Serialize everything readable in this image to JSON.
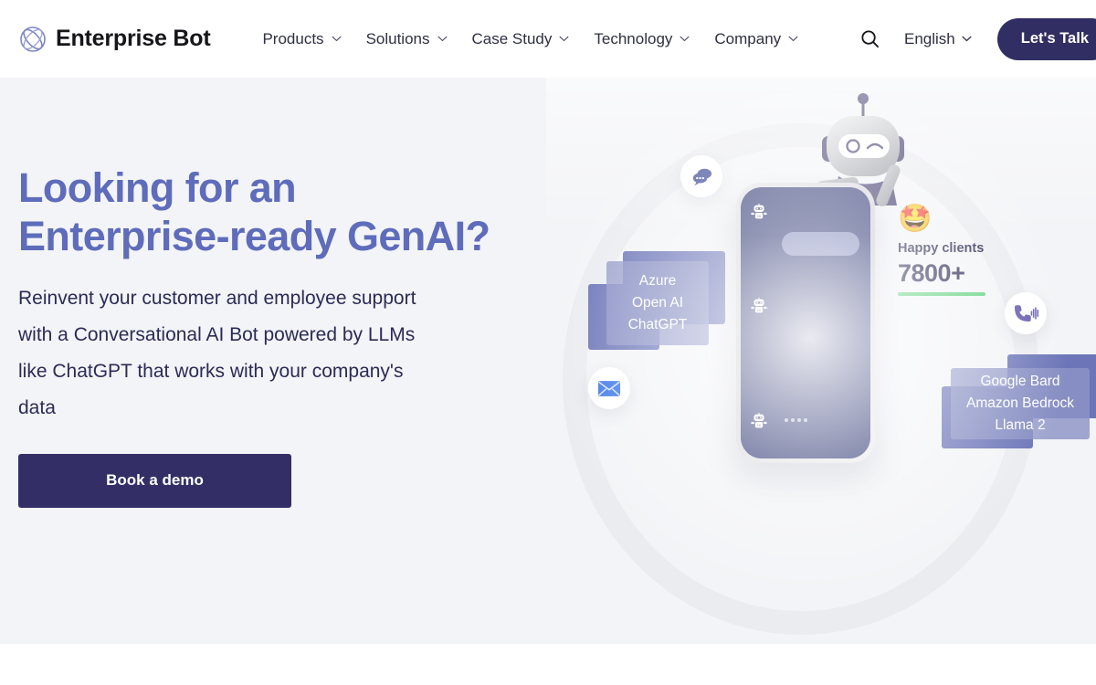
{
  "brand": {
    "name": "Enterprise Bot",
    "logo_icon": "orbit-swirl-icon"
  },
  "nav": {
    "items": [
      {
        "label": "Products",
        "has_dropdown": true,
        "icon": "chevron-down-icon"
      },
      {
        "label": "Solutions",
        "has_dropdown": true,
        "icon": "chevron-down-icon"
      },
      {
        "label": "Case Study",
        "has_dropdown": true,
        "icon": "chevron-down-icon"
      },
      {
        "label": "Technology",
        "has_dropdown": true,
        "icon": "chevron-down-icon"
      },
      {
        "label": "Company",
        "has_dropdown": true,
        "icon": "chevron-down-icon"
      }
    ],
    "search_icon": "search-icon",
    "language": {
      "label": "English",
      "icon": "chevron-down-icon"
    },
    "cta": {
      "label": "Let's Talk",
      "color": "#312e63"
    }
  },
  "hero": {
    "title_line1": "Looking for an",
    "title_line2": "Enterprise-ready GenAI?",
    "title_color": "#5e6cbb",
    "subtitle": "Reinvent your customer and employee support with a Conversational AI Bot powered by LLMs like ChatGPT that works with your company's data",
    "subtitle_color": "#2b2b55",
    "cta": {
      "label": "Book a demo",
      "color": "#332f66"
    },
    "background_color": "#f3f4f7"
  },
  "illustration": {
    "robot_icon": "robot-mascot-icon",
    "phone": {
      "screen_color": "#27306f",
      "avatars": [
        "bot-avatar-icon",
        "bot-avatar-icon",
        "bot-avatar-icon"
      ],
      "typing_indicator": "typing-dots-icon"
    },
    "floating_icons": [
      {
        "name": "chat-bubbles-icon",
        "color": "#2b3a8c"
      },
      {
        "name": "email-envelope-icon",
        "color": "#3b76e8"
      },
      {
        "name": "voice-call-icon",
        "color": "#6257ad"
      }
    ],
    "tech_cards_left": {
      "lines": [
        "Azure",
        "Open AI",
        "ChatGPT"
      ]
    },
    "tech_cards_right": {
      "lines": [
        "Google Bard",
        "Amazon Bedrock",
        "Llama 2"
      ]
    },
    "stats": {
      "emoji": "🤩",
      "emoji_name": "star-struck-emoji",
      "label": "Happy clients",
      "value": "7800+",
      "bar_color": "#5ed07c"
    }
  }
}
